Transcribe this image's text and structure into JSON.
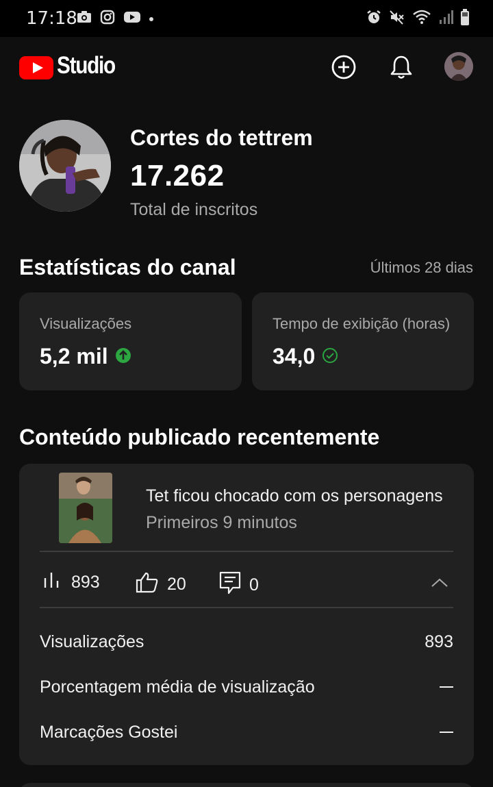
{
  "status_bar": {
    "time": "17:18",
    "left_icons": [
      "camera-icon",
      "instagram-icon",
      "youtube-icon",
      "dot"
    ],
    "right_icons": [
      "alarm-icon",
      "mute-icon",
      "wifi-icon",
      "signal-icon",
      "battery-icon"
    ]
  },
  "app_bar": {
    "brand": "Studio",
    "actions": [
      "create-icon",
      "bell-icon",
      "account-avatar"
    ]
  },
  "channel": {
    "name": "Cortes do tettrem",
    "subscribers": "17.262",
    "subscribers_label": "Total de inscritos"
  },
  "stats": {
    "title": "Estatísticas do canal",
    "period": "Últimos 28 dias",
    "cards": [
      {
        "label": "Visualizações",
        "value": "5,2 mil",
        "status": "up",
        "status_color": "#2ba640"
      },
      {
        "label": "Tempo de exibição (horas)",
        "value": "34,0",
        "status": "ok",
        "status_color": "#2ba640"
      }
    ]
  },
  "recent": {
    "title": "Conteúdo publicado recentemente",
    "video": {
      "title": "Tet ficou chocado com os personagens",
      "subtitle": "Primeiros 9 minutos",
      "views": "893",
      "likes": "20",
      "comments": "0"
    },
    "details": [
      {
        "label": "Visualizações",
        "value": "893"
      },
      {
        "label": "Porcentagem média de visualização",
        "value": ""
      },
      {
        "label": "Marcações Gostei",
        "value": ""
      }
    ]
  },
  "colors": {
    "background": "#0f0f0f",
    "card": "#212121",
    "brand_red": "#ff0000",
    "muted_text": "#aaaaaa",
    "positive": "#2ba640"
  }
}
